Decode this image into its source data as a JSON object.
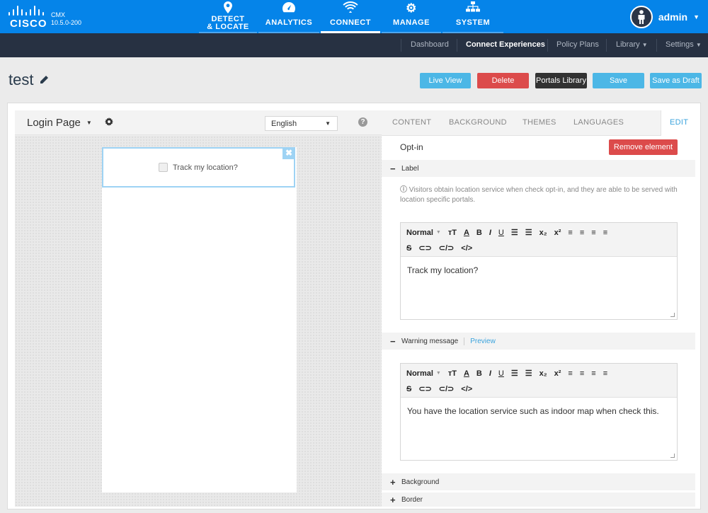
{
  "brand": {
    "word": "CISCO",
    "product": "CMX",
    "version": "10.5.0-200"
  },
  "nav": [
    {
      "line1": "DETECT",
      "line2": "& LOCATE",
      "icon": "map-pin-icon"
    },
    {
      "line1": "ANALYTICS",
      "icon": "gauge-icon"
    },
    {
      "line1": "CONNECT",
      "icon": "wifi-icon"
    },
    {
      "line1": "MANAGE",
      "icon": "gears-icon"
    },
    {
      "line1": "SYSTEM",
      "icon": "sitemap-icon"
    }
  ],
  "user": {
    "name": "admin"
  },
  "subnav": [
    "Dashboard",
    "Connect Experiences",
    "Policy Plans",
    "Library",
    "Settings"
  ],
  "page": {
    "title": "test"
  },
  "actions": {
    "live_view": "Live View",
    "delete": "Delete",
    "portals_library": "Portals Library",
    "save": "Save",
    "save_draft": "Save as Draft"
  },
  "left": {
    "page_select": "Login Page",
    "language": "English",
    "help": "?"
  },
  "canvas": {
    "optin_label": "Track my location?",
    "close": "✖"
  },
  "tabs": [
    "CONTENT",
    "BACKGROUND",
    "THEMES",
    "LANGUAGES",
    "EDIT"
  ],
  "edit": {
    "element_title": "Opt-in",
    "remove": "Remove element",
    "label_section": "Label",
    "info": "Visitors obtain location service when check opt-in, and they are able to be served with location specific portals.",
    "toolbar_normal": "Normal",
    "label_text": "Track my location?",
    "warning_section": "Warning message",
    "preview": "Preview",
    "warning_text": "You have the location service such as indoor map when check this.",
    "background_section": "Background",
    "border_section": "Border"
  },
  "colors": {
    "topbar": "#0584e9",
    "subnav": "#273142",
    "accent": "#4cb7e6",
    "danger": "#dc4b4b"
  }
}
